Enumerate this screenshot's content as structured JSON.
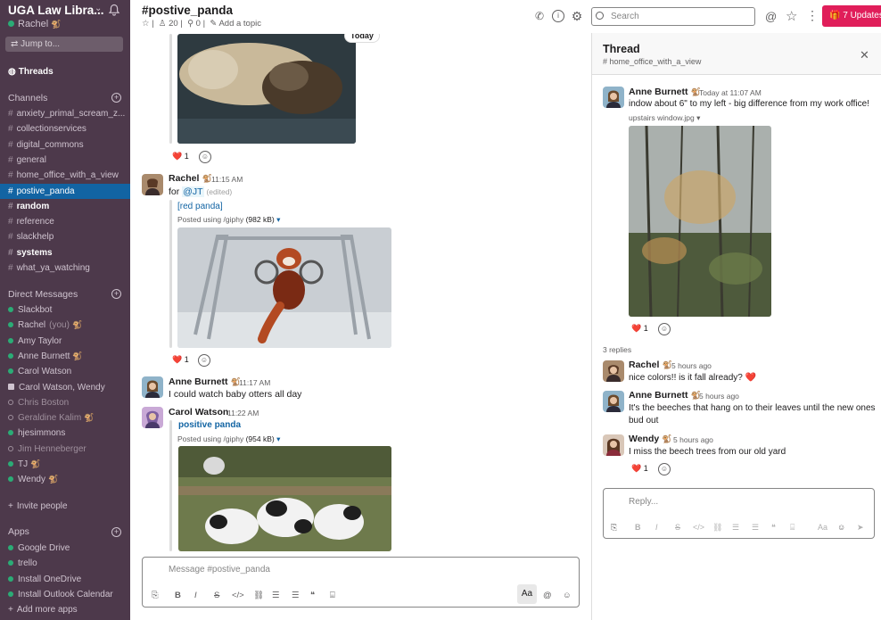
{
  "workspace": {
    "name": "UGA Law Libra...",
    "user": "Rachel",
    "user_emoji": "🐒"
  },
  "jump_to": "Jump to...",
  "sidebar": {
    "threads": "Threads",
    "channels_header": "Channels",
    "channels": [
      {
        "label": "anxiety_primal_scream_z...",
        "bold": false
      },
      {
        "label": "collectionservices",
        "bold": false
      },
      {
        "label": "digital_commons",
        "bold": false
      },
      {
        "label": "general",
        "bold": false
      },
      {
        "label": "home_office_with_a_view",
        "bold": false
      },
      {
        "label": "postive_panda",
        "active": true
      },
      {
        "label": "random",
        "bold": true
      },
      {
        "label": "reference",
        "bold": false
      },
      {
        "label": "slackhelp",
        "bold": false
      },
      {
        "label": "systems",
        "bold": true
      },
      {
        "label": "what_ya_watching",
        "bold": false
      }
    ],
    "dm_header": "Direct Messages",
    "dms": [
      {
        "label": "Slackbot",
        "status": "online"
      },
      {
        "label": "Rachel",
        "suffix": "(you)",
        "emoji": "🐒",
        "status": "online"
      },
      {
        "label": "Amy Taylor",
        "status": "online"
      },
      {
        "label": "Anne Burnett",
        "emoji": "🐒",
        "status": "online"
      },
      {
        "label": "Carol Watson",
        "status": "online"
      },
      {
        "label": "Carol Watson, Wendy",
        "status": "group"
      },
      {
        "label": "Chris Boston",
        "status": "offline"
      },
      {
        "label": "Geraldine Kalim",
        "emoji": "🐒",
        "status": "offline"
      },
      {
        "label": "hjesimmons",
        "status": "online"
      },
      {
        "label": "Jim Henneberger",
        "status": "offline"
      },
      {
        "label": "TJ",
        "emoji": "🐒",
        "status": "online"
      },
      {
        "label": "Wendy",
        "emoji": "🐒",
        "status": "online"
      }
    ],
    "invite": "Invite people",
    "apps_header": "Apps",
    "apps": [
      "Google Drive",
      "trello",
      "Install OneDrive",
      "Install Outlook Calendar",
      "Add more apps"
    ]
  },
  "channel": {
    "title": "#postive_panda",
    "members": "20",
    "pins": "0",
    "add_topic": "Add a topic",
    "today": "Today"
  },
  "messages": {
    "first_reaction": {
      "emoji": "❤️",
      "count": "1"
    },
    "m1": {
      "author": "Rachel",
      "emoji": "🐒",
      "time": "11:15 AM",
      "text_prefix": "for",
      "mention": "@JT",
      "edited": "(edited)",
      "link": "[red panda]",
      "meta": "Posted using /giphy",
      "size": "(982 kB)",
      "reaction": {
        "emoji": "❤️",
        "count": "1"
      }
    },
    "m2": {
      "author": "Anne Burnett",
      "emoji": "🐒",
      "time": "11:17 AM",
      "text": "I could watch baby otters all day"
    },
    "m3": {
      "author": "Carol Watson",
      "time": "11:22 AM",
      "link": "positive panda",
      "meta": "Posted using /giphy",
      "size": "(954 kB)"
    }
  },
  "composer": {
    "placeholder": "Message #postive_panda",
    "aa": "Aa"
  },
  "search": {
    "placeholder": "Search"
  },
  "updates": {
    "label": "7 Updates"
  },
  "thread": {
    "title": "Thread",
    "channel": "# home_office_with_a_view",
    "parent": {
      "author": "Anne Burnett",
      "emoji": "🐒",
      "time": "Today at 11:07 AM",
      "text": "indow about 6\" to my left - big difference from my work office!",
      "file": "upstairs window.jpg",
      "reaction": {
        "emoji": "❤️",
        "count": "1"
      }
    },
    "replies_count": "3 replies",
    "replies": [
      {
        "author": "Rachel",
        "emoji": "🐒",
        "time": "5 hours ago",
        "text": "nice colors!! is it fall already? ❤️"
      },
      {
        "author": "Anne Burnett",
        "emoji": "🐒",
        "time": "5 hours ago",
        "text": "It's the beeches that hang on to their leaves until the new ones",
        "text2": "bud out"
      },
      {
        "author": "Wendy",
        "emoji": "🐒",
        "time": "5 hours ago",
        "text": "I miss the beech trees from our old yard",
        "reaction": {
          "emoji": "❤️",
          "count": "1"
        }
      }
    ],
    "reply_placeholder": "Reply..."
  }
}
